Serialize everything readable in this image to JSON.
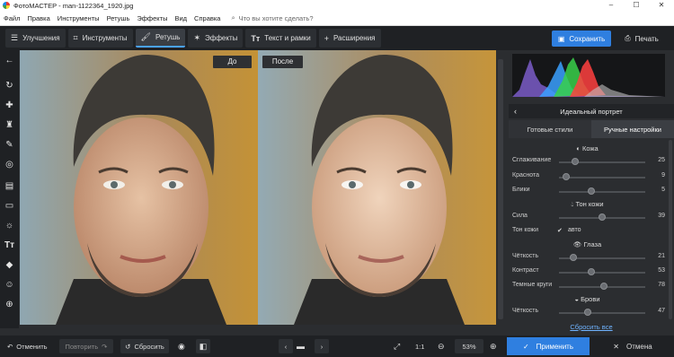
{
  "window": {
    "title": "ФотоМАСТЕР - man-1122364_1920.jpg",
    "min": "–",
    "max": "☐",
    "close": "✕"
  },
  "menu": {
    "items": [
      "Файл",
      "Правка",
      "Инструменты",
      "Ретушь",
      "Эффекты",
      "Вид",
      "Справка"
    ],
    "search_placeholder": "Что вы хотите сделать?"
  },
  "toolbar": {
    "tabs": [
      {
        "label": "Улучшения",
        "icon": "sliders-icon"
      },
      {
        "label": "Инструменты",
        "icon": "crop-icon"
      },
      {
        "label": "Ретушь",
        "icon": "brush-icon",
        "active": true
      },
      {
        "label": "Эффекты",
        "icon": "magic-wand-icon"
      },
      {
        "label": "Текст и рамки",
        "icon": "text-icon"
      },
      {
        "label": "Расширения",
        "icon": "plus-icon"
      }
    ],
    "save_label": "Сохранить",
    "print_label": "Печать"
  },
  "compare": {
    "before": "До",
    "after": "После"
  },
  "panel": {
    "title": "Идеальный портрет",
    "tabs": [
      "Готовые стили",
      "Ручные настройки"
    ],
    "sections": {
      "skin": "Кожа",
      "skin_tone": "Тон кожи",
      "eyes": "Глаза",
      "brows": "Брови"
    },
    "sliders": {
      "smoothing": {
        "label": "Сглаживание",
        "value": "25"
      },
      "redness": {
        "label": "Краснота",
        "value": "9"
      },
      "glare": {
        "label": "Блики",
        "value": "5"
      },
      "strength": {
        "label": "Сила",
        "value": "39"
      },
      "sharpness": {
        "label": "Чёткость",
        "value": "21"
      },
      "contrast": {
        "label": "Контраст",
        "value": "53"
      },
      "dark_circles": {
        "label": "Темные круги",
        "value": "78"
      },
      "brow_sharpness": {
        "label": "Чёткость",
        "value": "47"
      }
    },
    "skin_tone_label": "Тон кожи",
    "auto_label": "авто",
    "reset_all": "Сбросить все"
  },
  "bottom": {
    "undo": "Отменить",
    "redo": "Повторить",
    "reset": "Сбросить",
    "ratio": "1:1",
    "zoom": "53%",
    "apply": "Применить",
    "cancel": "Отмена"
  },
  "colors": {
    "accent": "#2f7fe0",
    "background": "#2b2d30",
    "toolbar": "#1f2124"
  }
}
